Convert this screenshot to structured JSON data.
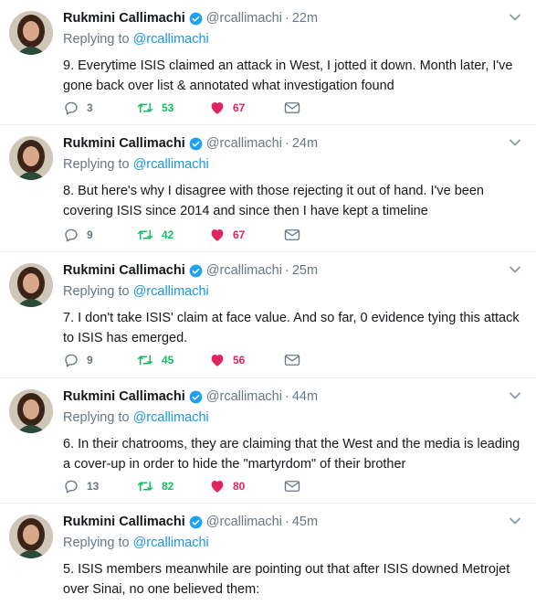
{
  "tweets": [
    {
      "name": "Rukmini Callimachi",
      "handle": "@rcallimachi",
      "time": "22m",
      "replying_prefix": "Replying to",
      "replying_to": "@rcallimachi",
      "text": "9. Everytime ISIS claimed an attack in West, I jotted it down. Month later, I've gone back over list & annotated what investigation found",
      "replies": "3",
      "retweets": "53",
      "likes": "67"
    },
    {
      "name": "Rukmini Callimachi",
      "handle": "@rcallimachi",
      "time": "24m",
      "replying_prefix": "Replying to",
      "replying_to": "@rcallimachi",
      "text": "8. But here's why I disagree with those rejecting it out of hand. I've been covering ISIS since 2014 and since then I have kept a timeline",
      "replies": "9",
      "retweets": "42",
      "likes": "67"
    },
    {
      "name": "Rukmini Callimachi",
      "handle": "@rcallimachi",
      "time": "25m",
      "replying_prefix": "Replying to",
      "replying_to": "@rcallimachi",
      "text": "7. I don't take ISIS' claim at face value. And so far, 0 evidence tying this attack to ISIS has emerged.",
      "replies": "9",
      "retweets": "45",
      "likes": "56"
    },
    {
      "name": "Rukmini Callimachi",
      "handle": "@rcallimachi",
      "time": "44m",
      "replying_prefix": "Replying to",
      "replying_to": "@rcallimachi",
      "text": "6. In their chatrooms, they are claiming that the West and the media is leading a cover-up in order to hide the \"martyrdom\" of their brother",
      "replies": "13",
      "retweets": "82",
      "likes": "80"
    },
    {
      "name": "Rukmini Callimachi",
      "handle": "@rcallimachi",
      "time": "45m",
      "replying_prefix": "Replying to",
      "replying_to": "@rcallimachi",
      "text": "5. ISIS members meanwhile are pointing out that after ISIS downed Metrojet over Sinai, no one believed them:"
    }
  ],
  "icons": {
    "verified": "verified-badge-icon",
    "reply": "reply-icon",
    "retweet": "retweet-icon",
    "like": "heart-icon",
    "dm": "envelope-icon",
    "menu": "chevron-down-icon"
  },
  "colors": {
    "link": "#1b95e0",
    "retweet_active": "#17bf63",
    "like_active": "#e0245e",
    "muted": "#657786"
  }
}
